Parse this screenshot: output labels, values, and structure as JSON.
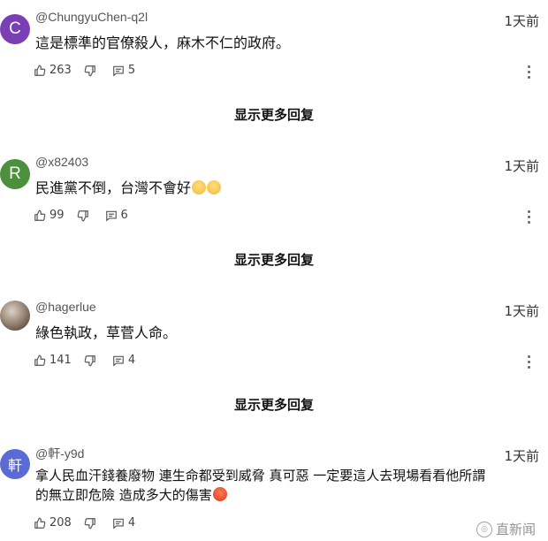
{
  "comments": [
    {
      "avatar_letter": "C",
      "avatar_color": "#7b3fb4",
      "username": "@ChungyuChen-q2l",
      "time": "1天前",
      "text": "這是標準的官僚殺人，麻木不仁的政府。",
      "likes": "263",
      "replies": "5"
    },
    {
      "avatar_letter": "R",
      "avatar_color": "#4c8f3c",
      "username": "@x82403",
      "time": "1天前",
      "text": "民進黨不倒，台灣不會好",
      "text_emoji": "pensive-face-emoji ×2",
      "likes": "99",
      "replies": "6"
    },
    {
      "avatar_letter": "",
      "avatar_color": "#6b5a4a",
      "username": "@hagerlue",
      "time": "1天前",
      "text": "綠色執政，草菅人命。",
      "likes": "141",
      "replies": "4"
    },
    {
      "avatar_letter": "軒",
      "avatar_color": "#5b6bd6",
      "username": "@軒-y9d",
      "time": "1天前",
      "text_line1": "拿人民血汗錢養廢物 連生命都受到威脅 真可惡 一定要這人去現場看看他所謂",
      "text_line2": "的無立即危險 造成多大的傷害",
      "text_emoji": "angry-face-emoji",
      "likes": "208",
      "replies": "4"
    }
  ],
  "show_more_label": "显示更多回复",
  "watermark": "直新闻",
  "icons": [
    "thumbs-up-icon",
    "thumbs-down-icon",
    "reply-icon",
    "more-vertical-icon"
  ]
}
